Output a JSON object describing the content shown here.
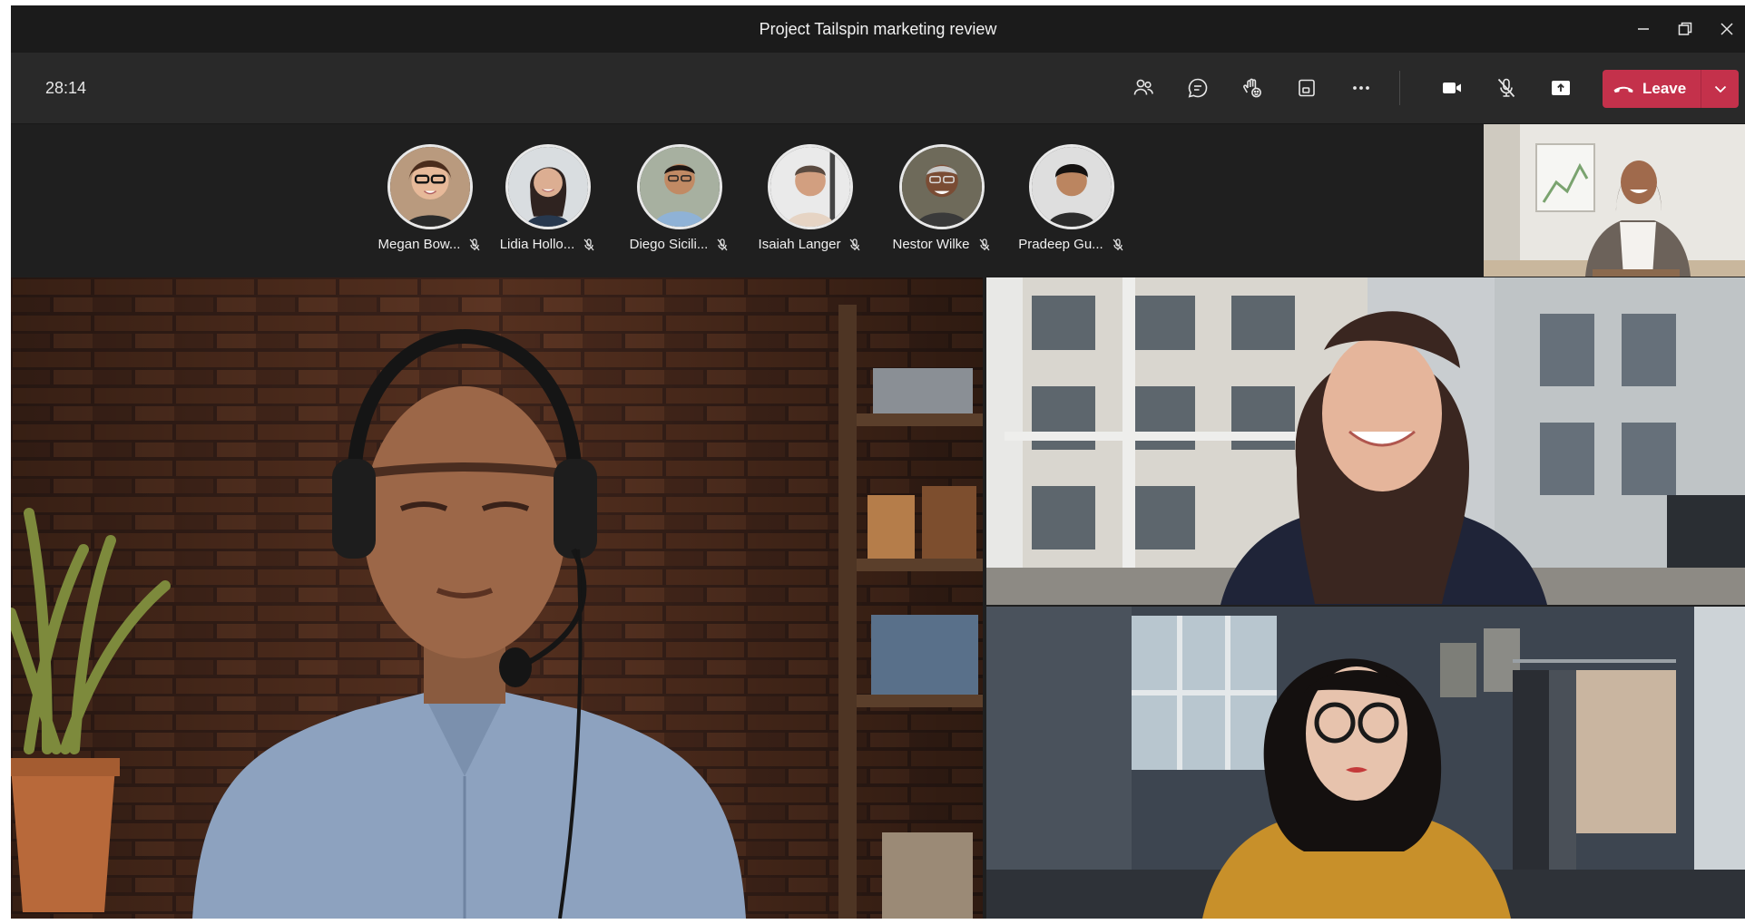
{
  "window": {
    "title": "Project Tailspin marketing review",
    "controls": [
      "minimize-icon",
      "restore-icon",
      "close-icon"
    ]
  },
  "toolbar": {
    "timer": "28:14",
    "buttons": [
      "people-icon",
      "chat-icon",
      "raise-hand-icon",
      "view-icon",
      "more-icon",
      "camera-icon",
      "mic-off-icon",
      "share-icon"
    ],
    "leave_label": "Leave"
  },
  "participants": [
    {
      "name": "Megan Bow...",
      "muted": true
    },
    {
      "name": "Lidia Hollo...",
      "muted": true
    },
    {
      "name": "Diego Sicili...",
      "muted": true
    },
    {
      "name": "Isaiah Langer",
      "muted": true
    },
    {
      "name": "Nestor Wilke",
      "muted": true
    },
    {
      "name": "Pradeep Gu...",
      "muted": true
    }
  ],
  "colors": {
    "background": "#1f1f1f",
    "toolbar": "#292929",
    "leave": "#c4314b"
  }
}
